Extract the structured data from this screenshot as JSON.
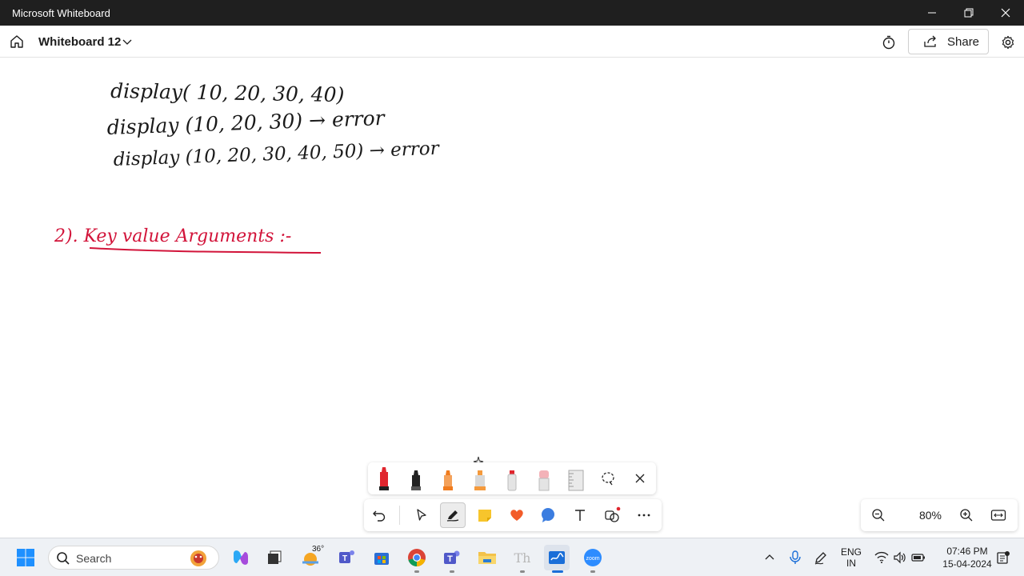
{
  "window": {
    "app_title": "Microsoft Whiteboard"
  },
  "header": {
    "board_title": "Whiteboard 12",
    "share_label": "Share"
  },
  "ink": [
    {
      "text": "display( 10, 20, 30, 40)",
      "color": "#1a1a1a"
    },
    {
      "text": "display (10, 20, 30) → error",
      "color": "#1a1a1a"
    },
    {
      "text": "display (10, 20, 30, 40, 50) → error",
      "color": "#1a1a1a"
    },
    {
      "text": "2). Key value Arguments :-",
      "color": "#d2143a"
    }
  ],
  "pen_tray": {
    "pens": [
      {
        "name": "red-pen",
        "color": "#e0262e"
      },
      {
        "name": "black-pen",
        "color": "#222222"
      },
      {
        "name": "orange-pen",
        "color": "#f07c1e"
      },
      {
        "name": "highlighter",
        "color": "#f59a3c"
      },
      {
        "name": "eraser",
        "color": "#d9d9d9"
      },
      {
        "name": "pink-eraser",
        "color": "#f3b2b8"
      },
      {
        "name": "ruler",
        "color": "#cfcfcf"
      }
    ]
  },
  "zoom": {
    "level": "80%"
  },
  "taskbar": {
    "search_label": "Search",
    "weather_temp": "36°",
    "language_line1": "ENG",
    "language_line2": "IN",
    "time": "07:46 PM",
    "date": "15-04-2024"
  },
  "colors": {
    "accent": "#0067c0",
    "ink_red": "#d2143a"
  }
}
